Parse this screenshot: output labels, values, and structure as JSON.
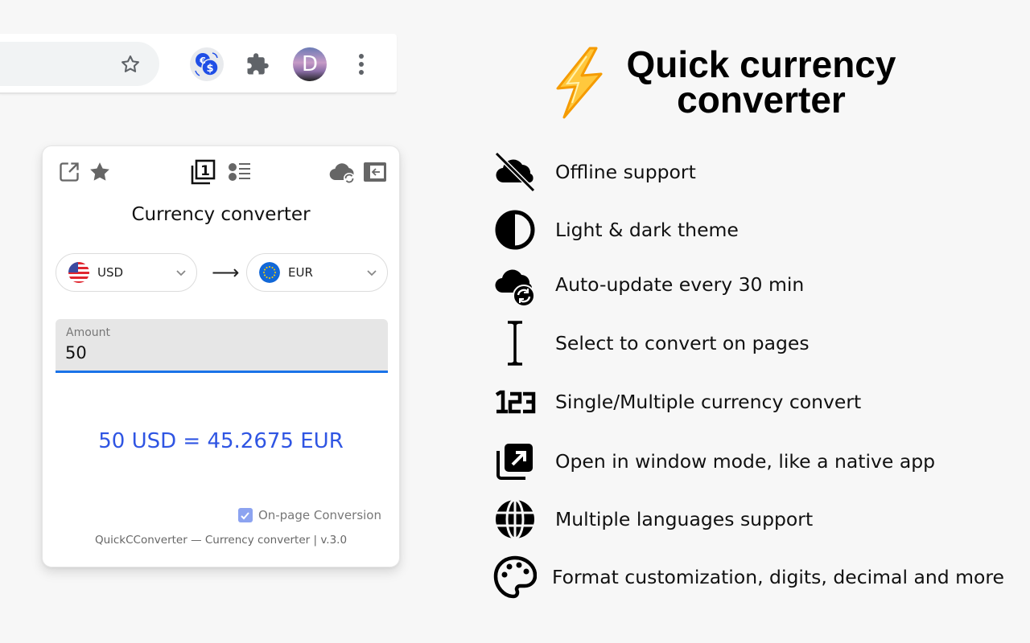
{
  "browser_toolbar": {
    "bookmark_icon": "star-outline-icon",
    "extension_icon": "currency-exchange-icon",
    "extensions_icon": "puzzle-icon",
    "profile_initial": "D",
    "menu_icon": "more-vert-icon"
  },
  "popup": {
    "header_icons": {
      "left": [
        "open-external-icon",
        "star-icon"
      ],
      "center": [
        "single-mode-icon",
        "multi-list-icon"
      ],
      "right": [
        "cloud-sync-icon",
        "collapse-panel-icon"
      ]
    },
    "title": "Currency converter",
    "from_currency": {
      "code": "USD",
      "flag": "us-flag"
    },
    "to_currency": {
      "code": "EUR",
      "flag": "eu-flag"
    },
    "direction_arrow": "⟶",
    "amount": {
      "label": "Amount",
      "value": "50"
    },
    "result": "50 USD = 45.2675 EUR",
    "onpage_conversion": {
      "label": "On-page Conversion",
      "checked": true
    },
    "footer": "QuickCConverter — Currency converter | v.3.0"
  },
  "promo": {
    "title_line1": "Quick currency",
    "title_line2": "converter",
    "features": [
      {
        "icon": "cloud-off-icon",
        "text": "Offline support"
      },
      {
        "icon": "contrast-icon",
        "text": "Light & dark theme"
      },
      {
        "icon": "cloud-sync-icon",
        "text": "Auto-update every 30 min"
      },
      {
        "icon": "text-cursor-icon",
        "text": "Select to convert on pages"
      },
      {
        "icon": "numbers-123-icon",
        "text": "Single/Multiple currency convert"
      },
      {
        "icon": "open-in-window-icon",
        "text": "Open in window mode, like a native app"
      },
      {
        "icon": "globe-icon",
        "text": "Multiple languages support"
      },
      {
        "icon": "palette-icon",
        "text": "Format customization, digits, decimal and more"
      }
    ]
  },
  "colors": {
    "accent_blue": "#1a73e8",
    "result_blue": "#2f55e3",
    "checkbox_blue": "#8ca3f0",
    "extension_blue": "#1f4ee6",
    "bolt_yellow": "#ffc83d"
  }
}
